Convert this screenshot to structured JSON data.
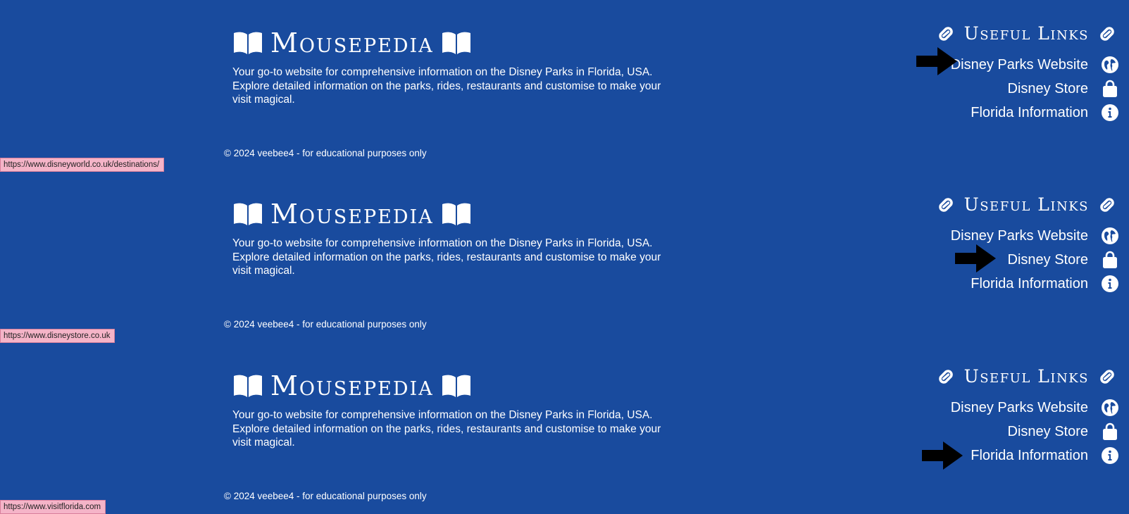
{
  "brand": {
    "title": "Mousepedia",
    "tagline": "Your go-to website for comprehensive information on the Disney Parks in Florida, USA. Explore detailed information on the parks, rides, restaurants and customise to make your visit magical.",
    "copyright": "© 2024 veebee4 - for educational purposes only",
    "icon": "open-book-icon"
  },
  "useful_links": {
    "title": "Useful Links",
    "icon": "link-icon",
    "items": [
      {
        "label": "Disney Parks Website",
        "icon": "globe-icon"
      },
      {
        "label": "Disney Store",
        "icon": "shopping-bag-icon"
      },
      {
        "label": "Florida Information",
        "icon": "info-circle-icon"
      }
    ]
  },
  "panels": [
    {
      "hovered_link": "Disney Parks Website",
      "status_url": "https://www.disneyworld.co.uk/destinations/"
    },
    {
      "hovered_link": "Disney Store",
      "status_url": "https://www.disneystore.co.uk"
    },
    {
      "hovered_link": "Florida Information",
      "status_url": "https://www.visitflorida.com"
    }
  ],
  "colors": {
    "background": "#194b9e",
    "text": "#ffffff",
    "status_tip": "#f5b4c8",
    "arrow": "#000000"
  }
}
